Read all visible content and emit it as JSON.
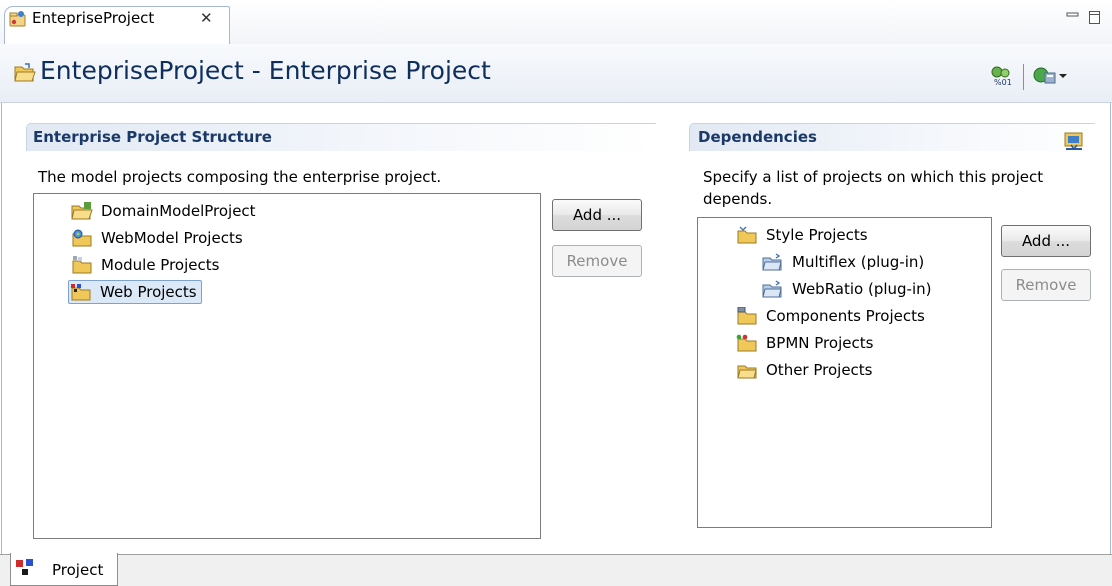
{
  "editor_tab": {
    "label": "EntepriseProject",
    "close_glyph": "✕",
    "icon": "enterprise-project-icon"
  },
  "form": {
    "title": "EntepriseProject - Enterprise Project",
    "title_icon": "open-folder-icon",
    "actions": [
      "generate-project-icon",
      "run-menu-icon"
    ]
  },
  "structure_section": {
    "title": "Enterprise Project Structure",
    "description": "The model projects composing the enterprise project.",
    "items": [
      {
        "label": "DomainModelProject",
        "icon": "domain-model-folder-icon"
      },
      {
        "label": "WebModel Projects",
        "icon": "webmodel-folder-icon"
      },
      {
        "label": "Module Projects",
        "icon": "module-folder-icon"
      },
      {
        "label": "Web Projects",
        "icon": "web-folder-icon",
        "selected": true
      }
    ],
    "add_label": "Add ...",
    "remove_label": "Remove"
  },
  "dependencies_section": {
    "title": "Dependencies",
    "description_line1": "Specify a list of projects on which this project",
    "description_line2": "depends.",
    "items": [
      {
        "label": "Style Projects",
        "icon": "style-folder-icon",
        "level": 0
      },
      {
        "label": "Multiflex  (plug-in)",
        "icon": "plugin-project-icon",
        "level": 1
      },
      {
        "label": "WebRatio  (plug-in)",
        "icon": "plugin-project-icon",
        "level": 1
      },
      {
        "label": "Components Projects",
        "icon": "components-folder-icon",
        "level": 0
      },
      {
        "label": "BPMN Projects",
        "icon": "bpmn-folder-icon",
        "level": 0
      },
      {
        "label": "Other Projects",
        "icon": "other-folder-icon",
        "level": 0
      }
    ],
    "add_label": "Add ...",
    "remove_label": "Remove"
  },
  "page_tabs": [
    {
      "label": "Project",
      "icon": "project-page-icon"
    }
  ],
  "colors": {
    "title_text": "#0e2e5c",
    "section_title": "#1a3966",
    "selection_bg": "#dbe8f8",
    "selection_border": "#7da2ce"
  }
}
